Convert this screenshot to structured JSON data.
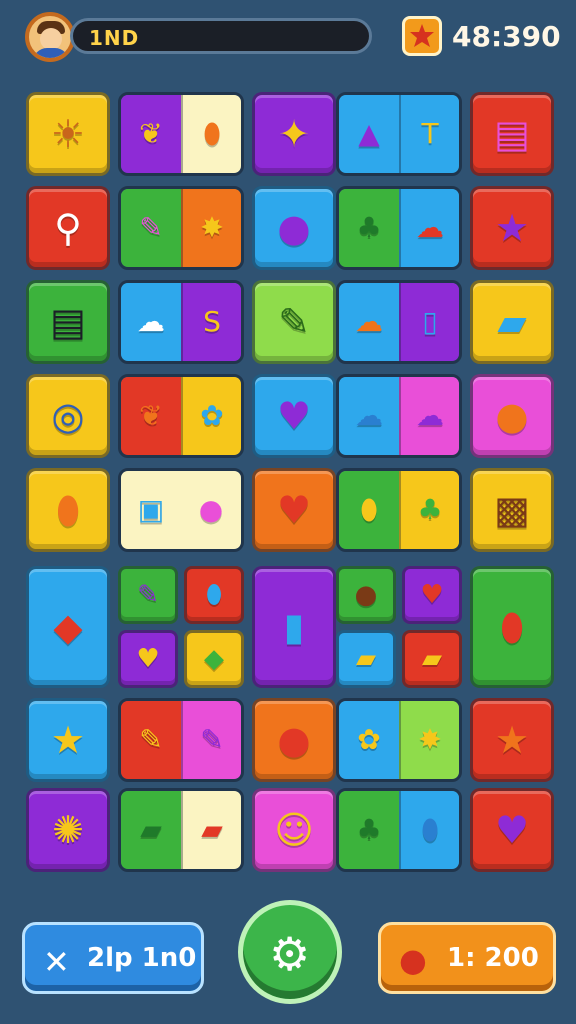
{
  "header": {
    "player_name": "1ND",
    "score": "48:390"
  },
  "footer": {
    "left_button_label": "2lp 1n0",
    "right_button_label": "1: 200"
  },
  "colors": {
    "yellow": "#f6c71b",
    "purple": "#8e2bd6",
    "blue": "#2ea8ec",
    "red": "#e23826",
    "green": "#3cb33c",
    "orange": "#f0741c",
    "pink": "#e94fd8",
    "lime": "#8fdc4b",
    "cream": "#fbf4c2"
  },
  "icons": {
    "sun": "☀",
    "leaf": "❦",
    "bird": "✦",
    "cassette": "▤",
    "magnifier": "⚲",
    "star": "★",
    "heart": "♥",
    "flower": "✿",
    "blob": "●",
    "diamond": "◆",
    "pencil": "✎",
    "drop": "💧",
    "ring": "◎",
    "cloud": "☁",
    "balloon": "⬮",
    "tree": "♣",
    "spade": "♠",
    "sparkle": "✧"
  }
}
